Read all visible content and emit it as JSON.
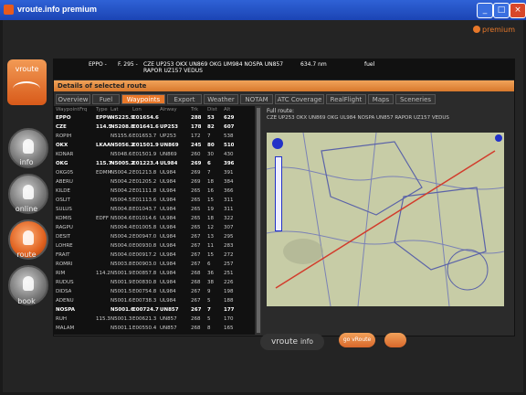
{
  "window": {
    "title": "vroute.info premium"
  },
  "brand": "premium",
  "sidebar": {
    "route_top": "vroute",
    "items": [
      {
        "label": "info"
      },
      {
        "label": "online"
      },
      {
        "label": "route"
      },
      {
        "label": "book"
      }
    ]
  },
  "route_info": {
    "from": "EPPO -",
    "to": "- EPPG",
    "fl": "F. 295 -",
    "dist": "F. 295",
    "route": "CZE UP253 OKX UN869 OKG UM984 NOSPA UN857",
    "route2": "RAPOR UZ157 VEDUS",
    "dist_val": "634.7 nm",
    "other": "fuel"
  },
  "section_title": "Details of selected route",
  "tabs": [
    {
      "label": "Overview"
    },
    {
      "label": "Fuel"
    },
    {
      "label": "Waypoints"
    },
    {
      "label": "Export"
    },
    {
      "label": "Weather"
    },
    {
      "label": "NOTAM"
    },
    {
      "label": "ATC Coverage"
    },
    {
      "label": "RealFlight"
    },
    {
      "label": "Maps"
    },
    {
      "label": "Sceneries"
    }
  ],
  "table": {
    "headers": [
      "Waypoint",
      "Frq",
      "Type",
      "Lat",
      "Lon",
      "Airway",
      "Trk",
      "Dist",
      "Alt"
    ],
    "rows": [
      [
        "EPPO",
        "",
        "EPPW",
        "N5225.9",
        "E01654.6",
        "",
        "288",
        "53",
        "629"
      ],
      [
        "CZE",
        "",
        "114.5",
        "N5208.8",
        "E01641.6",
        "UP253",
        "178",
        "82",
        "607"
      ],
      [
        "ROPIH",
        "",
        "",
        "N5155.6",
        "E01653.7",
        "UP253",
        "172",
        "7",
        "538"
      ],
      [
        "OKX",
        "",
        "LKAA",
        "N5056.2",
        "E01501.9",
        "UN869",
        "245",
        "80",
        "510"
      ],
      [
        "KONAR",
        "",
        "",
        "N5048.6",
        "E01501.9",
        "UN869",
        "260",
        "30",
        "430"
      ],
      [
        "OKG",
        "",
        "115.7",
        "N5005.2",
        "E01223.4",
        "UL984",
        "269",
        "6",
        "396"
      ],
      [
        "OKG05",
        "",
        "EDMM",
        "N5004.2",
        "E01213.8",
        "UL984",
        "269",
        "7",
        "391"
      ],
      [
        "ABERU",
        "",
        "",
        "N5004.2",
        "E01205.2",
        "UL984",
        "269",
        "18",
        "384"
      ],
      [
        "KILDE",
        "",
        "",
        "N5004.2",
        "E01111.8",
        "UL984",
        "265",
        "16",
        "366"
      ],
      [
        "OSLIT",
        "",
        "",
        "N5004.5",
        "E01113.6",
        "UL984",
        "265",
        "15",
        "311"
      ],
      [
        "SULUS",
        "",
        "",
        "N5004.8",
        "E01043.7",
        "UL984",
        "265",
        "19",
        "311"
      ],
      [
        "KOMIS",
        "",
        "EDFF",
        "N5004.6",
        "E01014.6",
        "UL984",
        "265",
        "18",
        "322"
      ],
      [
        "RAGPU",
        "",
        "",
        "N5004.4",
        "E01005.8",
        "UL984",
        "265",
        "12",
        "307"
      ],
      [
        "DESIT",
        "",
        "",
        "N5004.2",
        "E00947.0",
        "UL984",
        "267",
        "13",
        "295"
      ],
      [
        "LOHRE",
        "",
        "",
        "N5004.0",
        "E00930.8",
        "UL984",
        "267",
        "11",
        "283"
      ],
      [
        "FRAIT",
        "",
        "",
        "N5004.0",
        "E00917.2",
        "UL984",
        "267",
        "15",
        "272"
      ],
      [
        "ROMRI",
        "",
        "",
        "N5003.8",
        "E00903.0",
        "UL984",
        "267",
        "6",
        "257"
      ],
      [
        "RIM",
        "",
        "114.2",
        "N5001.9",
        "E00857.8",
        "UL984",
        "268",
        "36",
        "251"
      ],
      [
        "RUDUS",
        "",
        "",
        "N5001.9",
        "E00830.8",
        "UL984",
        "268",
        "38",
        "226"
      ],
      [
        "DIDSA",
        "",
        "",
        "N5001.5",
        "E00754.8",
        "UL984",
        "267",
        "9",
        "198"
      ],
      [
        "ADENU",
        "",
        "",
        "N5001.6",
        "E00738.3",
        "UL984",
        "267",
        "5",
        "188"
      ],
      [
        "NOSPA",
        "",
        "",
        "N5001.6",
        "E00724.7",
        "UN857",
        "267",
        "7",
        "177"
      ],
      [
        "RUH",
        "",
        "115.3",
        "N5001.3",
        "E00621.3",
        "UN857",
        "268",
        "5",
        "170"
      ],
      [
        "MALAM",
        "",
        "",
        "N5001.1",
        "E00550.4",
        "UN857",
        "268",
        "8",
        "165"
      ]
    ]
  },
  "full_route": {
    "label": "Full route:",
    "text": "CZE UP253 OKX UN869 OKG UL984 NOSPA UN857 RAPOR UZ157 VEDUS"
  },
  "footer": {
    "logo": "vroute",
    "logo_sub": "info",
    "btn1": "go vRoute",
    "btn2": ""
  }
}
